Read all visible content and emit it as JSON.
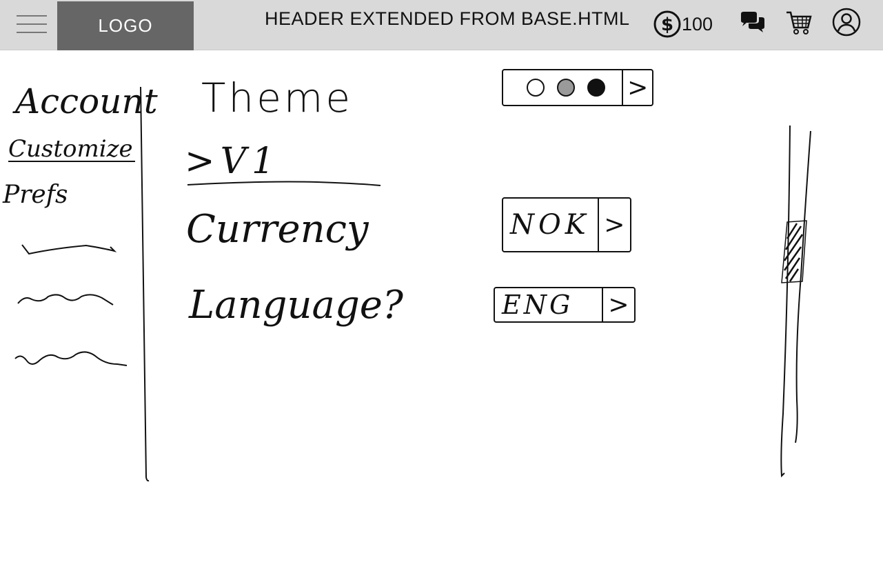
{
  "header": {
    "logo": "LOGO",
    "title": "HEADER EXTENDED FROM BASE.HTML",
    "coins": "100"
  },
  "sidebar": {
    "items": [
      {
        "label": "Account"
      },
      {
        "label": "Customize"
      },
      {
        "label": "Prefs"
      }
    ]
  },
  "settings": {
    "theme": {
      "label": "Theme",
      "arrow": ">"
    },
    "ui": {
      "label": ">V1"
    },
    "currency": {
      "label": "Currency",
      "value": "NOK",
      "arrow": ">"
    },
    "language": {
      "label": "Language?",
      "value": "ENG",
      "arrow": ">"
    }
  },
  "theme_swatches": [
    "#ffffff",
    "#9a9a9a",
    "#111111"
  ],
  "colors": {
    "header_bg": "#d9d9d9",
    "logo_bg": "#666666"
  }
}
